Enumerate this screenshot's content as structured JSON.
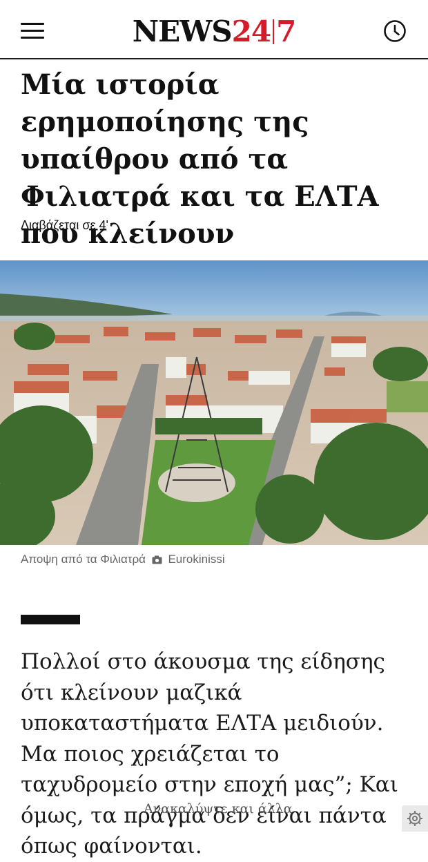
{
  "header": {
    "logo_part1": "NEWS",
    "logo_part2": "24",
    "logo_part3": "7",
    "menu_icon": "hamburger-menu-icon",
    "history_icon": "clock-icon",
    "brand_color": "#d51a2a"
  },
  "article": {
    "title": "Μία ιστορία ερημοποίησης της υπαίθρου από τα Φιλιατρά και τα ΕΛΤΑ που κλείνουν",
    "read_time": "Διαβάζεται σε 4'",
    "caption": "Αποψη από τα Φιλιατρά",
    "photo_credit": "Eurokinissi",
    "body": "Πολλοί στο άκουσμα της είδησης ότι κλείνουν μαζικά υποκαταστήματα ΕΛΤΑ μειδιούν. Μα ποιος χρειάζεται το ταχυδρομείο στην εποχή μας”; Και όμως, τα πράγμα δεν είναι πάντα όπως φαίνονται."
  },
  "footer": {
    "discover_label": "Ανακαλύψτε και άλλα",
    "settings_icon": "gear-icon"
  }
}
